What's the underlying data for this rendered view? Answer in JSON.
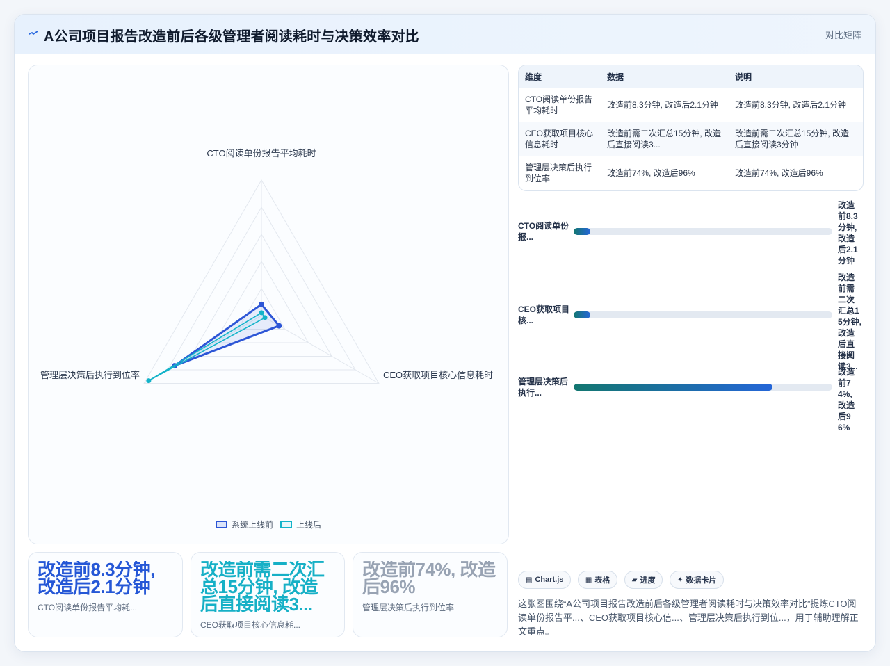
{
  "header": {
    "title": "A公司项目报告改造前后各级管理者阅读耗时与决策效率对比",
    "tag": "对比矩阵"
  },
  "chart_data": {
    "type": "radar",
    "axes": [
      "CTO阅读单份报告平均耗时",
      "CEO获取项目核心信息耗时",
      "管理层决策后执行到位率"
    ],
    "series": [
      {
        "name": "系统上线前",
        "values": [
          8.3,
          15,
          74
        ],
        "color": "#2d56d6"
      },
      {
        "name": "上线后",
        "values": [
          2.1,
          3,
          96
        ],
        "color": "#13b3c9"
      }
    ],
    "radial_max": 100,
    "rings": 5
  },
  "table": {
    "headers": [
      "维度",
      "数据",
      "说明"
    ],
    "rows": [
      [
        "CTO阅读单份报告平均耗时",
        "改造前8.3分钟, 改造后2.1分钟",
        "改造前8.3分钟, 改造后2.1分钟"
      ],
      [
        "CEO获取项目核心信息耗时",
        "改造前需二次汇总15分钟, 改造后直接阅读3...",
        "改造前需二次汇总15分钟, 改造后直接阅读3分钟"
      ],
      [
        "管理层决策后执行到位率",
        "改造前74%, 改造后96%",
        "改造前74%, 改造后96%"
      ]
    ]
  },
  "bars": [
    {
      "label": "CTO阅读单份报...",
      "value": "改造前8.3分钟, 改造后2.1分钟",
      "fill_percent": 6.5
    },
    {
      "label": "CEO获取项目核...",
      "value": "改造前需二次汇总15分钟, 改造后直接阅读3...",
      "fill_percent": 6.5
    },
    {
      "label": "管理层决策后执行...",
      "value": "改造前74%, 改造后96%",
      "fill_percent": 77
    }
  ],
  "kpis": [
    {
      "value": "改造前8.3分钟, 改造后2.1分钟",
      "label": "CTO阅读单份报告平均耗...",
      "color": "#2557d6"
    },
    {
      "value": "改造前需二次汇总15分钟, 改造后直接阅读3...",
      "label": "CEO获取项目核心信息耗...",
      "color": "#16b0c6"
    },
    {
      "value": "改造前74%, 改造后96%",
      "label": "管理层决策后执行到位率",
      "color": "#98a3b3"
    }
  ],
  "chips": [
    {
      "icon": "chart-icon",
      "label": "Chart.js"
    },
    {
      "icon": "table-icon",
      "label": "表格"
    },
    {
      "icon": "progress-icon",
      "label": "进度"
    },
    {
      "icon": "sparkle-icon",
      "label": "数据卡片"
    }
  ],
  "summary": "这张图围绕“A公司项目报告改造前后各级管理者阅读耗时与决策效率对比”提炼CTO阅读单份报告平...、CEO获取项目核心信...、管理层决策后执行到位...，用于辅助理解正文重点。"
}
